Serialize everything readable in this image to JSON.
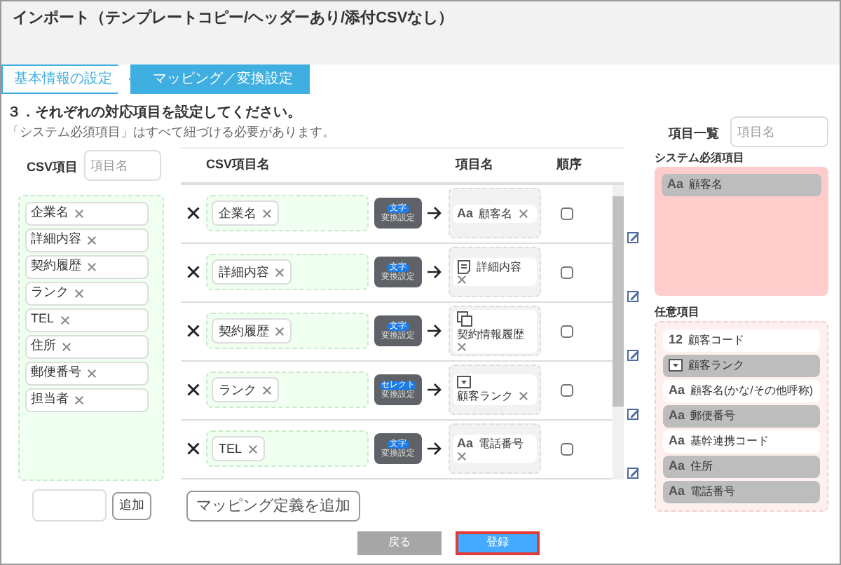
{
  "window": {
    "title": "インポート（テンプレートコピー/ヘッダーあり/添付CSVなし）"
  },
  "steps": [
    {
      "label": "基本情報の設定",
      "selected": false
    },
    {
      "label": "マッピング／変換設定",
      "selected": true
    }
  ],
  "heading": "３．それぞれの対応項目を設定してください。",
  "note": "「システム必須項目」はすべて紐づける必要があります。",
  "csv_panel": {
    "title": "CSV項目",
    "search_placeholder": "項目名",
    "items": [
      "企業名",
      "詳細内容",
      "契約履歴",
      "ランク",
      "TEL",
      "住所",
      "郵便番号",
      "担当者"
    ],
    "add_button": "追加"
  },
  "mapping": {
    "columns": [
      "CSV項目名",
      "項目名",
      "順序"
    ],
    "rows": [
      {
        "csv": "企業名",
        "conversion": {
          "kind": "text",
          "type": "文字",
          "label": "変換設定"
        },
        "field": {
          "kind": "text",
          "glyph": "Aa",
          "name": "顧客名"
        },
        "checked": false
      },
      {
        "csv": "詳細内容",
        "conversion": {
          "kind": "text",
          "type": "文字",
          "label": "変換設定"
        },
        "field": {
          "kind": "memo",
          "name": "詳細内容"
        },
        "checked": false
      },
      {
        "csv": "契約履歴",
        "conversion": {
          "kind": "text",
          "type": "文字",
          "label": "変換設定"
        },
        "field": {
          "kind": "relation",
          "name": "契約情報履歴"
        },
        "checked": false
      },
      {
        "csv": "ランク",
        "conversion": {
          "kind": "select",
          "type": "セレクト",
          "label": "変換設定"
        },
        "field": {
          "kind": "select",
          "name": "顧客ランク"
        },
        "checked": false
      },
      {
        "csv": "TEL",
        "conversion": {
          "kind": "text",
          "type": "文字",
          "label": "変換設定"
        },
        "field": {
          "kind": "text",
          "glyph": "Aa",
          "name": "電話番号"
        },
        "checked": false
      }
    ],
    "add_button": "マッピング定義を追加"
  },
  "field_list": {
    "title": "項目一覧",
    "search_placeholder": "項目名",
    "required": {
      "title": "システム必須項目",
      "items": [
        {
          "kind": "text",
          "glyph": "Aa",
          "name": "顧客名",
          "mapped": true
        }
      ]
    },
    "optional": {
      "title": "任意項目",
      "items": [
        {
          "kind": "number",
          "glyph": "12",
          "name": "顧客コード",
          "mapped": false
        },
        {
          "kind": "select",
          "name": "顧客ランク",
          "mapped": true
        },
        {
          "kind": "text",
          "glyph": "Aa",
          "name": "顧客名(かな/その他呼称)",
          "mapped": false
        },
        {
          "kind": "text",
          "glyph": "Aa",
          "name": "郵便番号",
          "mapped": true
        },
        {
          "kind": "text",
          "glyph": "Aa",
          "name": "基幹連携コード",
          "mapped": false
        },
        {
          "kind": "text",
          "glyph": "Aa",
          "name": "住所",
          "mapped": true
        },
        {
          "kind": "text",
          "glyph": "Aa",
          "name": "電話番号",
          "mapped": true
        }
      ]
    }
  },
  "buttons": [
    {
      "kind": "back",
      "label": "戻る"
    },
    {
      "kind": "submit",
      "label": "登録"
    }
  ]
}
